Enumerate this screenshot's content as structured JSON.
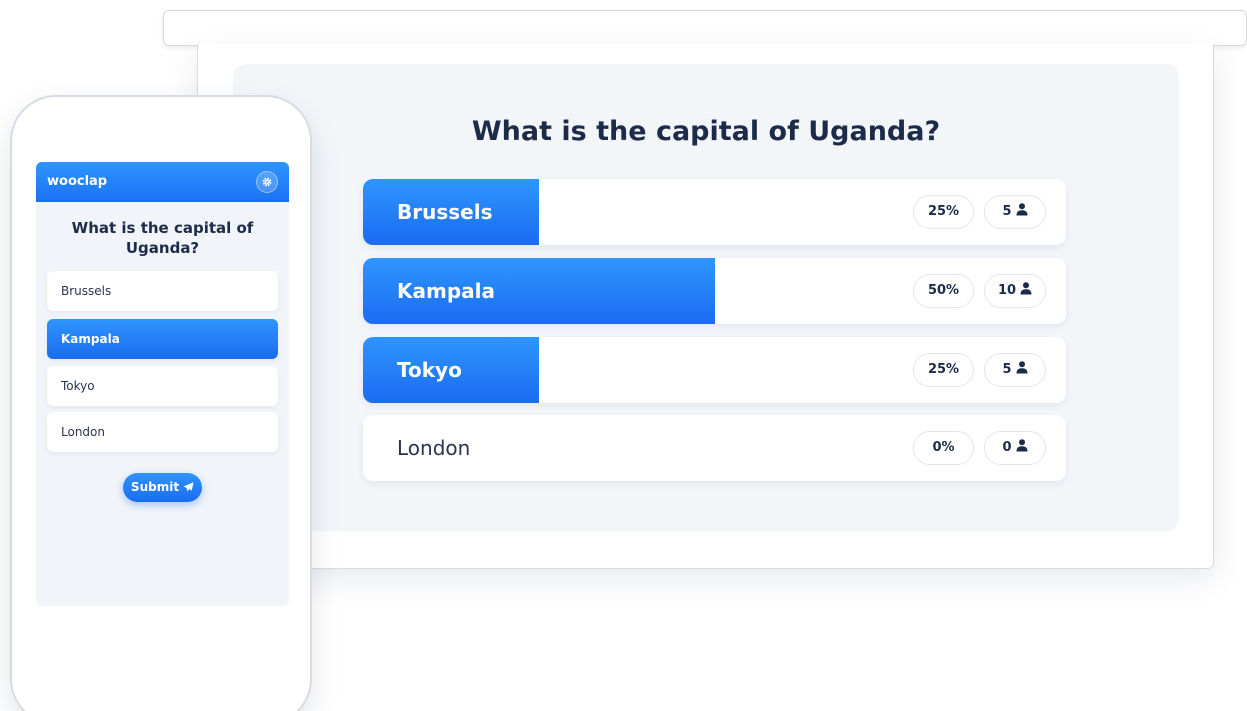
{
  "presentation": {
    "question": "What is the capital of Uganda?",
    "answers": [
      {
        "label": "Brussels",
        "percent": "25%",
        "count": "5",
        "share": 0.25
      },
      {
        "label": "Kampala",
        "percent": "50%",
        "count": "10",
        "share": 0.5
      },
      {
        "label": "Tokyo",
        "percent": "25%",
        "count": "5",
        "share": 0.25
      },
      {
        "label": "London",
        "percent": "0%",
        "count": "0",
        "share": 0
      }
    ]
  },
  "phone": {
    "brand": "wooclap",
    "question": "What is the capital of Uganda?",
    "options": [
      {
        "label": "Brussels",
        "selected": false
      },
      {
        "label": "Kampala",
        "selected": true
      },
      {
        "label": "Tokyo",
        "selected": false
      },
      {
        "label": "London",
        "selected": false
      }
    ],
    "submit_label": "Submit"
  },
  "colors": {
    "accent": "#1a6cf0",
    "accent_light": "#2f95ff",
    "text": "#1c2b4a",
    "panel": "#f3f6f9"
  },
  "icons": [
    "user-icon",
    "gear-icon",
    "paper-plane-icon"
  ]
}
